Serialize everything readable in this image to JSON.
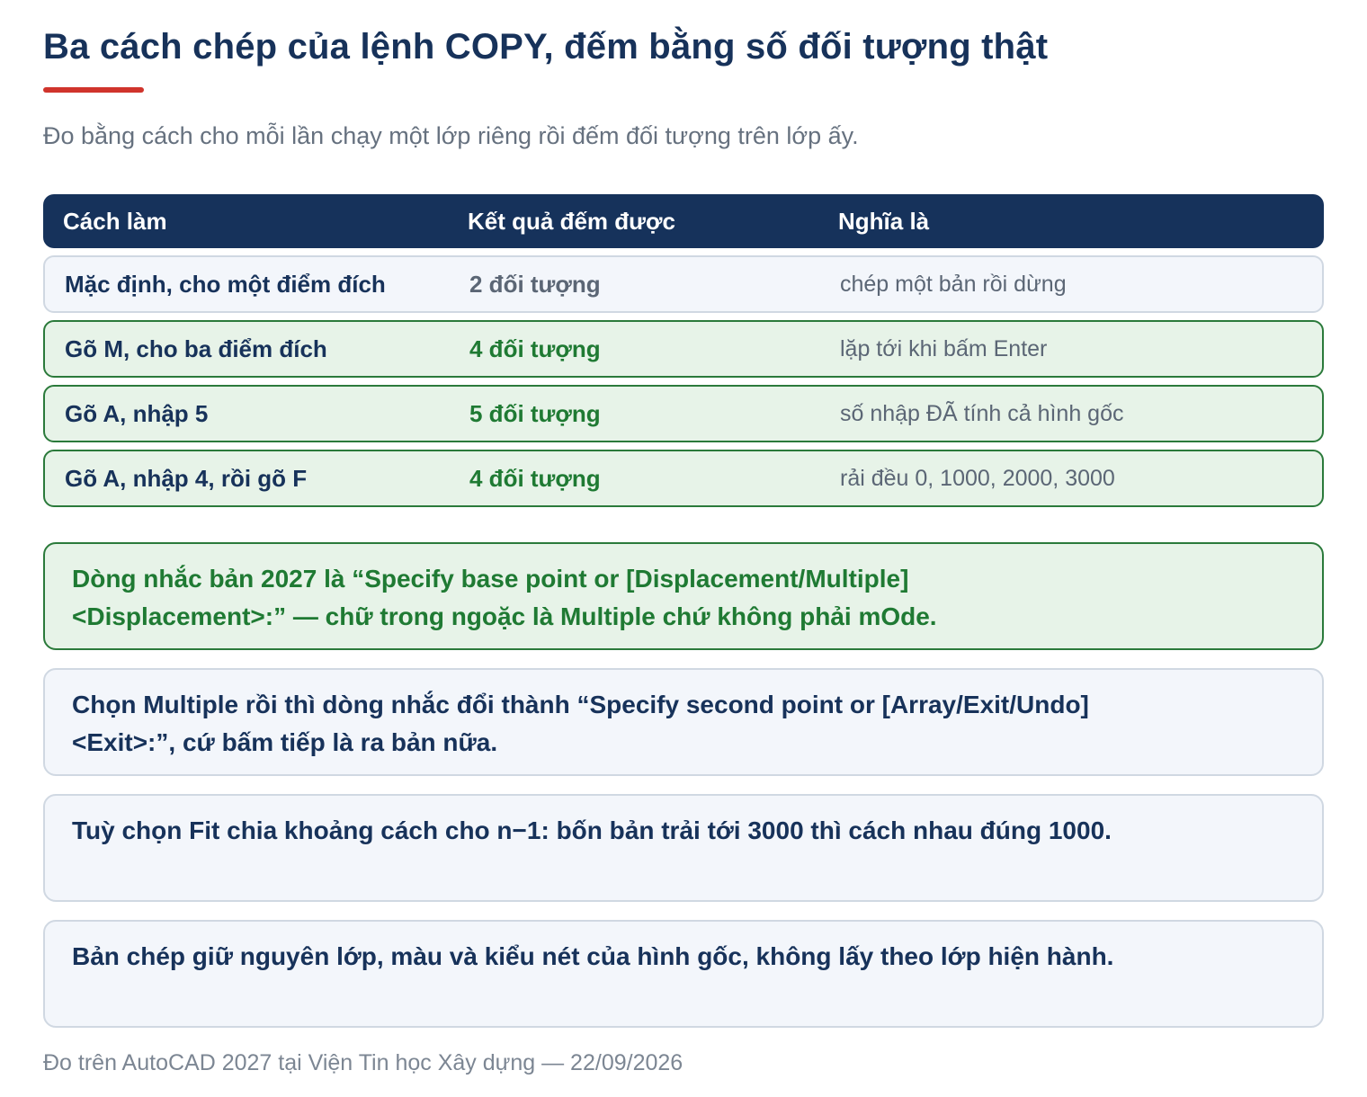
{
  "title": "Ba cách chép của lệnh COPY, đếm bằng số đối tượng thật",
  "subtitle": "Đo bằng cách cho mỗi lần chạy một lớp riêng rồi đếm đối tượng trên lớp ấy.",
  "table": {
    "headers": [
      "Cách làm",
      "Kết quả đếm được",
      "Nghĩa là"
    ],
    "rows": [
      {
        "method": "Mặc định, cho một điểm đích",
        "result": "2 đối tượng",
        "meaning": "chép một bản rồi dừng",
        "style": "neutral"
      },
      {
        "method": "Gõ M, cho ba điểm đích",
        "result": "4 đối tượng",
        "meaning": "lặp tới khi bấm Enter",
        "style": "good"
      },
      {
        "method": "Gõ A, nhập 5",
        "result": "5 đối tượng",
        "meaning": "số nhập ĐÃ tính cả hình gốc",
        "style": "good"
      },
      {
        "method": "Gõ A, nhập 4, rồi gõ F",
        "result": "4 đối tượng",
        "meaning": "rải đều 0, 1000, 2000, 3000",
        "style": "good"
      }
    ]
  },
  "notes": [
    {
      "text": "Dòng nhắc bản 2027 là “Specify base point or [Displacement/Multiple] <Displacement>:” — chữ trong ngoặc là Multiple chứ không phải mOde.",
      "style": "green"
    },
    {
      "text": "Chọn Multiple rồi thì dòng nhắc đổi thành “Specify second point or [Array/Exit/Undo] <Exit>:”, cứ bấm tiếp là ra bản nữa.",
      "style": "plain"
    },
    {
      "text": "Tuỳ chọn Fit chia khoảng cách cho n−1: bốn bản trải tới 3000 thì cách nhau đúng 1000.",
      "style": "plain"
    },
    {
      "text": "Bản chép giữ nguyên lớp, màu và kiểu nét của hình gốc, không lấy theo lớp hiện hành.",
      "style": "plain"
    }
  ],
  "footer": "Đo trên AutoCAD 2027 tại Viện Tin học Xây dựng — 22/09/2026",
  "colors": {
    "navy": "#16325b",
    "accent_red": "#d0342c",
    "green": "#1f7a33",
    "green_bg": "#e7f3e8",
    "neutral_bg": "#f3f6fb"
  }
}
